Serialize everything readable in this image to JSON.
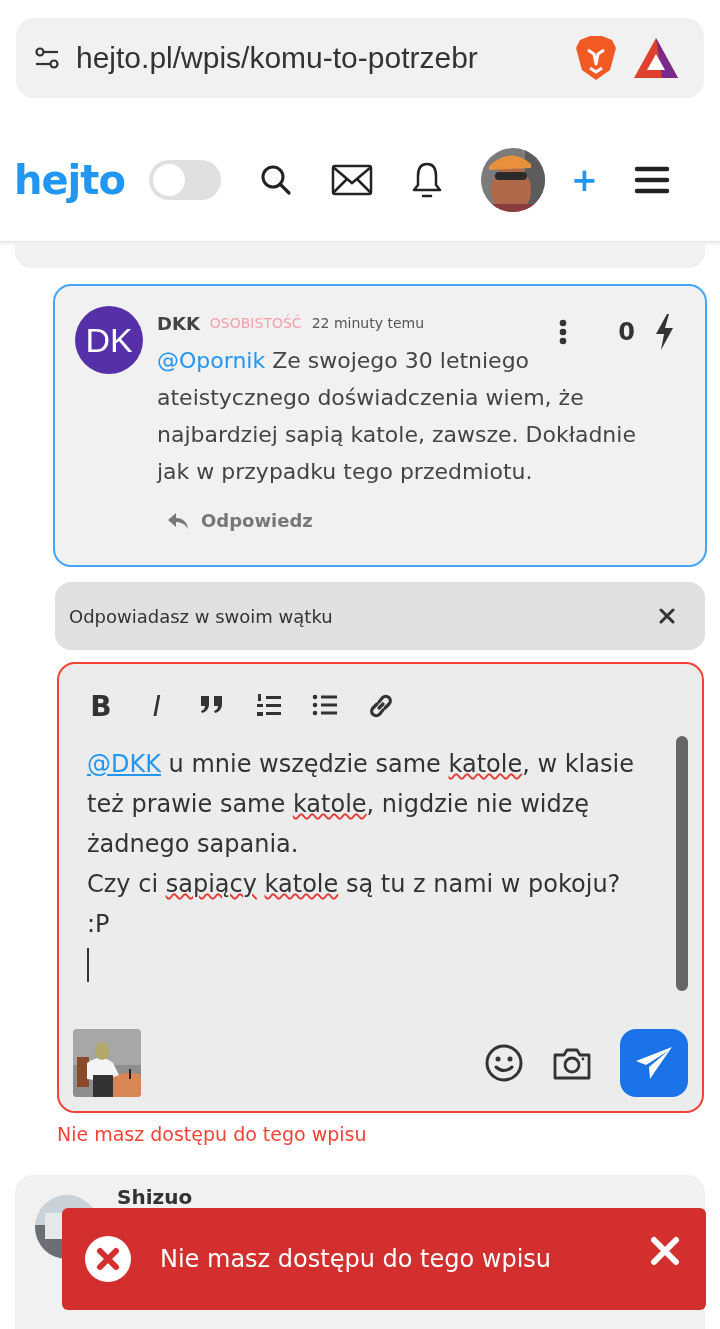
{
  "browser": {
    "url": "hejto.pl/wpis/komu-to-potrzebr"
  },
  "header": {
    "logo": "hejto",
    "dark_mode": {
      "on": false
    },
    "add_label": "+"
  },
  "comment": {
    "avatar_initials": "DK",
    "author": "DKK",
    "rank": "OSOBISTOŚĆ",
    "time": "22 minuty temu",
    "score": "0",
    "mention": "@Opornik",
    "text": " Ze swojego 30 letniego ateistycznego doświadczenia wiem, że najbardziej sapią katole, zawsze. Dokładnie jak w przypadku tego przedmiotu.",
    "reply_label": "Odpowiedz"
  },
  "reply_bar": {
    "text": "Odpowiadasz w swoim wątku"
  },
  "editor": {
    "toolbar": [
      {
        "kind": "bold",
        "label": "B"
      },
      {
        "kind": "italic",
        "label": "I"
      },
      {
        "kind": "quote"
      },
      {
        "kind": "ordered-list"
      },
      {
        "kind": "bullet-list"
      },
      {
        "kind": "link"
      }
    ],
    "segments": [
      {
        "kind": "mention",
        "text": "@DKK"
      },
      {
        "kind": "plain",
        "text": " u mnie wszędzie same "
      },
      {
        "kind": "misspelled",
        "text": "katole"
      },
      {
        "kind": "plain",
        "text": ", w klasie też prawie same "
      },
      {
        "kind": "misspelled",
        "text": "katole"
      },
      {
        "kind": "plain",
        "text": ", nigdzie nie widzę żadnego sapania.\nCzy ci "
      },
      {
        "kind": "misspelled",
        "text": "sapiący"
      },
      {
        "kind": "misspelled",
        "text": " katole"
      },
      {
        "kind": "plain",
        "text": " są tu z nami w pokoju? :P\n"
      }
    ],
    "error": true,
    "error_text": "Nie masz dostępu do tego wpisu"
  },
  "next_comment": {
    "author": "Shizuo"
  },
  "toast": {
    "text": "Nie masz dostępu do tego wpisu"
  }
}
